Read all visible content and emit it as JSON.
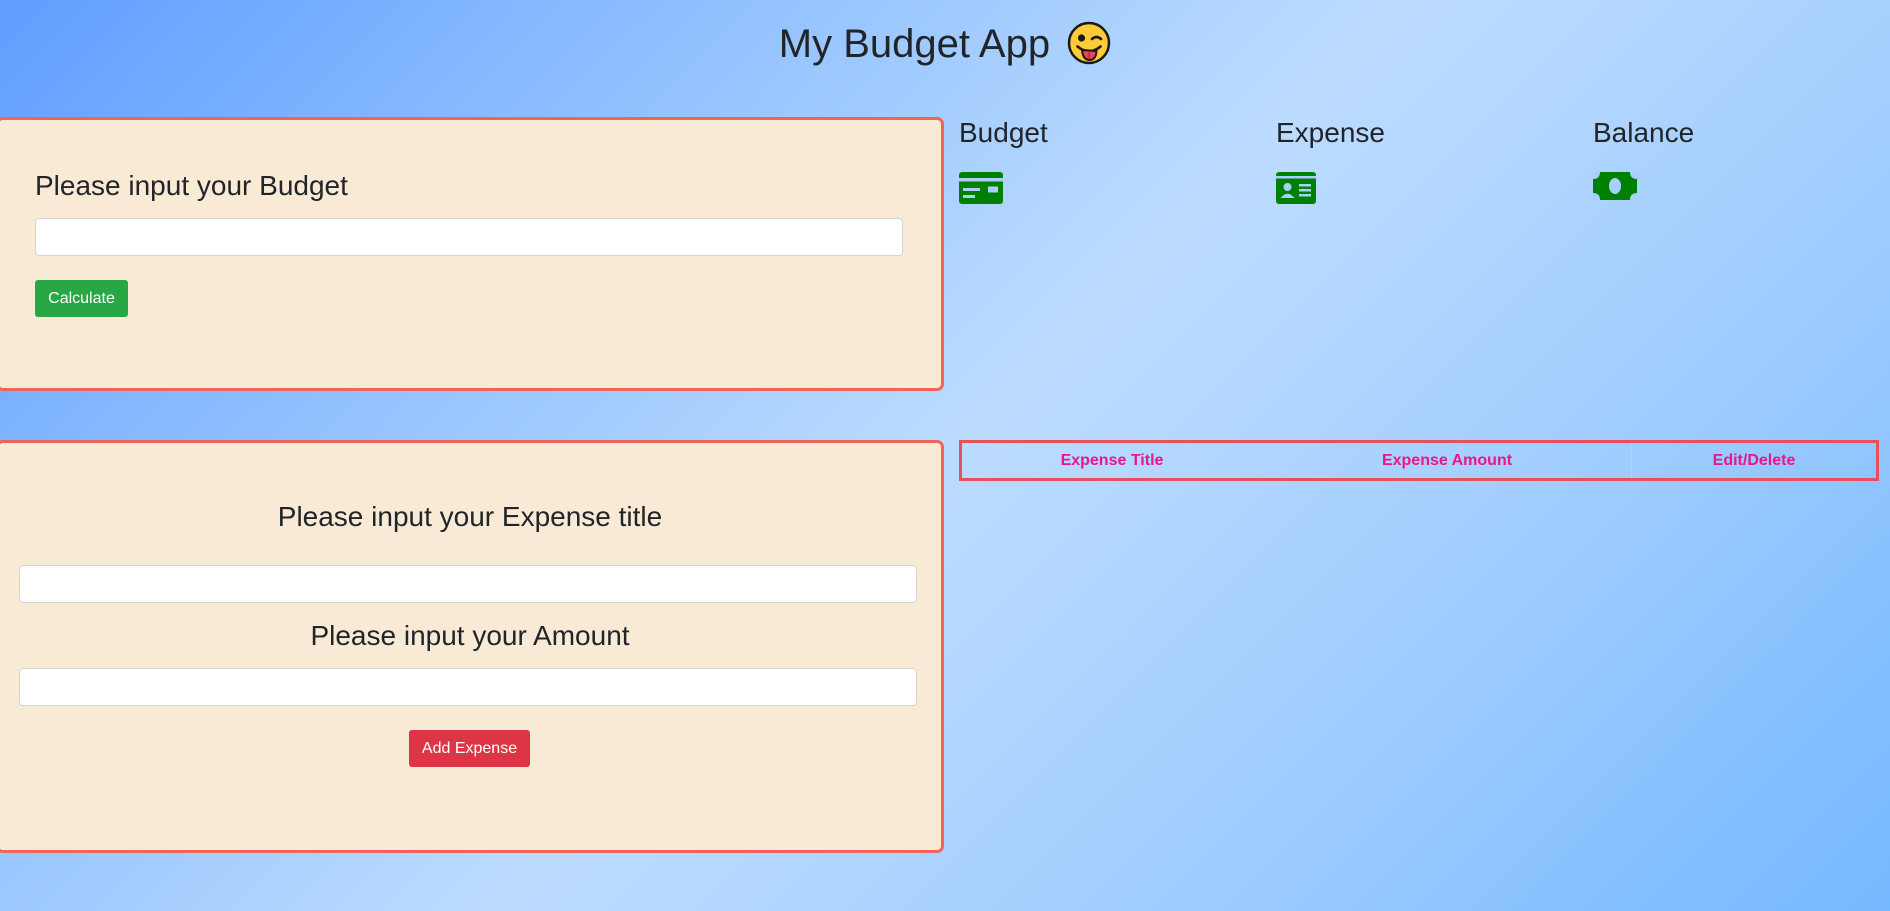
{
  "app": {
    "title": "My Budget App"
  },
  "budget_form": {
    "heading": "Please input your Budget",
    "input_value": "",
    "calculate_label": "Calculate"
  },
  "expense_form": {
    "title_heading": "Please input your Expense title",
    "title_value": "",
    "amount_heading": "Please input your Amount",
    "amount_value": "",
    "add_label": "Add Expense"
  },
  "summary": {
    "budget_label": "Budget",
    "budget_icon": "credit-card-icon",
    "expense_label": "Expense",
    "expense_icon": "id-card-icon",
    "balance_label": "Balance",
    "balance_icon": "money-bill-icon",
    "icon_color": "#008000"
  },
  "expense_table": {
    "columns": [
      "Expense Title",
      "Expense Amount",
      "Edit/Delete"
    ],
    "rows": []
  },
  "colors": {
    "panel_bg": "#f9ead6",
    "panel_border": "#f0655a",
    "calculate_button": "#28a745",
    "add_button": "#dc3545",
    "table_header_text": "#e8178a",
    "table_border": "#e8505b"
  }
}
